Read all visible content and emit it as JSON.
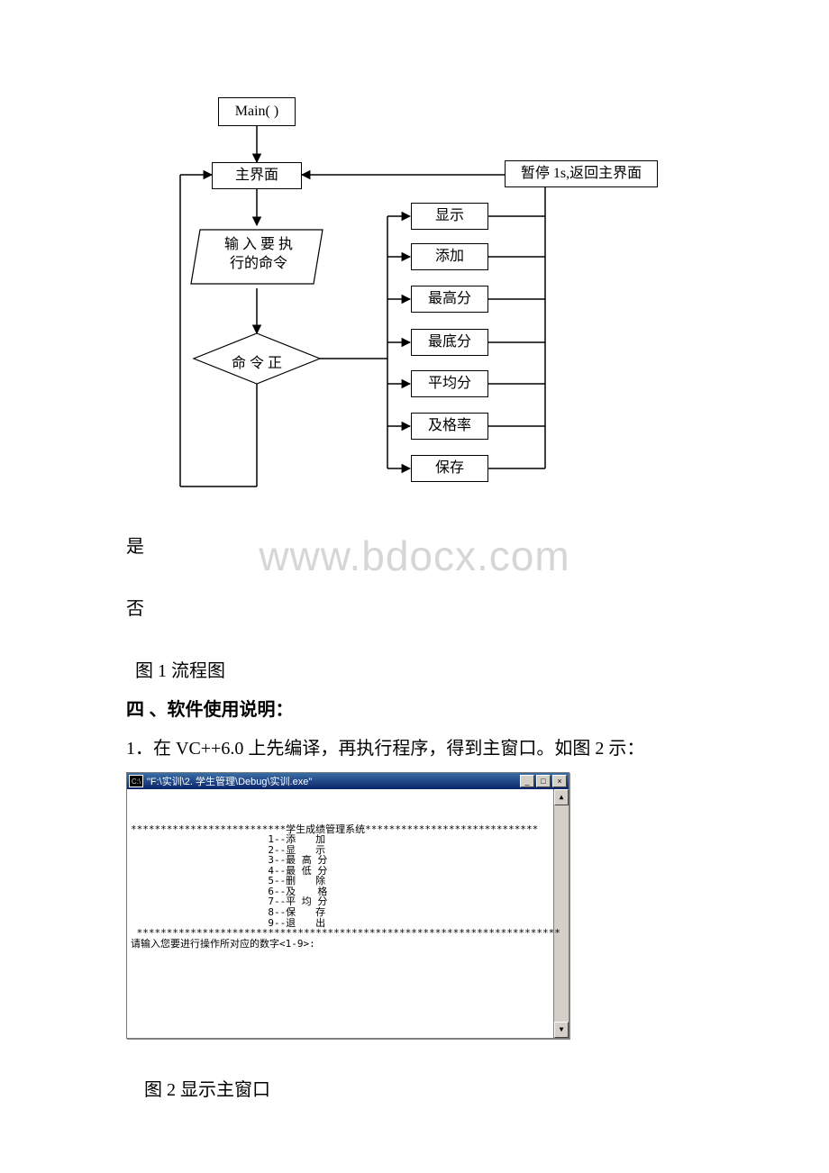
{
  "flow": {
    "main": "Main( )",
    "ui": "主界面",
    "pause": "暂停 1s,返回主界面",
    "input": "输 入 要 执\n行的命令",
    "decide": "命 令 正",
    "ops": [
      "显示",
      "添加",
      "最高分",
      "最底分",
      "平均分",
      "及格率",
      "保存"
    ]
  },
  "labels": {
    "yes": "是",
    "no": "否",
    "fig1": "图 1 流程图",
    "fig2": "图 2 显示主窗口"
  },
  "section": {
    "heading": "四 、软件使用说明：",
    "step1": "1．在 VC++6.0 上先编译，再执行程序，得到主窗口。如图 2 示："
  },
  "watermark": "www.bdocx.com",
  "console": {
    "titleIcon": "C:\\",
    "title": "\"F:\\实训\\2. 学生管理\\Debug\\实训.exe\"",
    "stars1": "**************************学生成绩管理系统*****************************",
    "menu": [
      "1--添　　加",
      "2--显　　示",
      "3--最 高 分",
      "4--最 低 分",
      "5--删　　除",
      "6--及 　 格",
      "7--平 均 分",
      "8--保　　存",
      "9--退　　出"
    ],
    "stars2": " ***********************************************************************",
    "prompt": "请输入您要进行操作所对应的数字<1-9>:"
  }
}
